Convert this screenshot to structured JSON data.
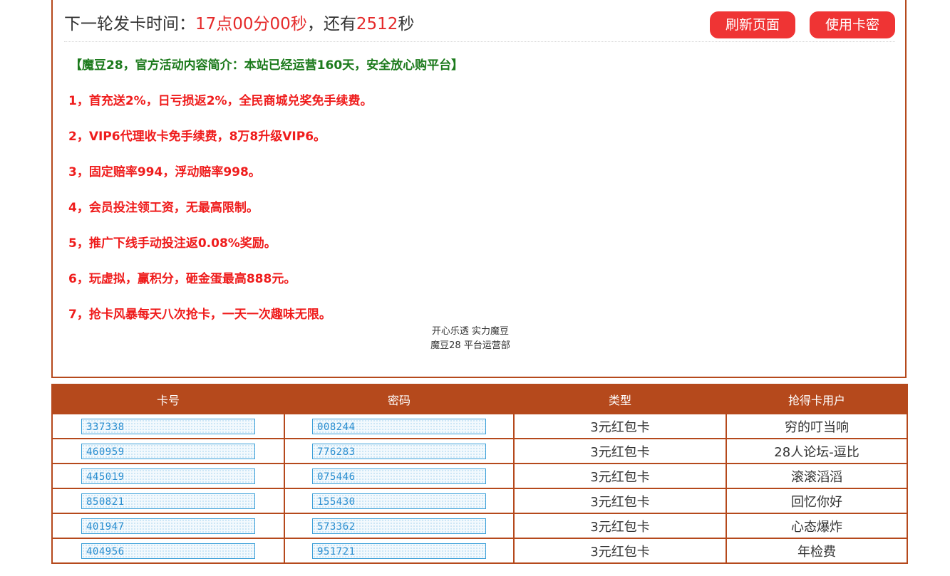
{
  "header": {
    "countdown_prefix": "下一轮发卡时间：",
    "countdown_time": "17点00分00秒",
    "countdown_mid": "，还有",
    "countdown_seconds": "2512",
    "countdown_suffix": "秒",
    "refresh_label": "刷新页面",
    "use_card_label": "使用卡密"
  },
  "announcement": {
    "title": "【魔豆28，官方活动内容简介：本站已经运营160天，安全放心购平台】",
    "items": [
      "1，首充送2%，日亏损返2%，全民商城兑奖免手续费。",
      "2，VIP6代理收卡免手续费，8万8升级VIP6。",
      "3，固定赔率994，浮动赔率998。",
      "4，会员投注领工资，无最高限制。",
      "5，推广下线手动投注返0.08%奖励。",
      "6，玩虚拟，赢积分，砸金蛋最高888元。",
      "7，抢卡风暴每天八次抢卡，一天一次趣味无限。"
    ],
    "signature_line1": "开心乐透  实力魔豆",
    "signature_line2": "魔豆28  平台运营部"
  },
  "table": {
    "headers": [
      "卡号",
      "密码",
      "类型",
      "抢得卡用户"
    ],
    "rows": [
      {
        "card": "337338",
        "password": "008244",
        "type": "3元红包卡",
        "user": "穷的叮当响"
      },
      {
        "card": "460959",
        "password": "776283",
        "type": "3元红包卡",
        "user": "28人论坛-逗比"
      },
      {
        "card": "445019",
        "password": "075446",
        "type": "3元红包卡",
        "user": "滚滚滔滔"
      },
      {
        "card": "850821",
        "password": "155430",
        "type": "3元红包卡",
        "user": "回忆你好"
      },
      {
        "card": "401947",
        "password": "573362",
        "type": "3元红包卡",
        "user": "心态爆炸"
      },
      {
        "card": "404956",
        "password": "951721",
        "type": "3元红包卡",
        "user": "年检费"
      }
    ]
  },
  "colors": {
    "accent": "#b5491c",
    "button": "#ef3434",
    "alert_red": "#ef1c1c",
    "title_green": "#1c7a1c",
    "code_blue": "#2a8ed0"
  }
}
